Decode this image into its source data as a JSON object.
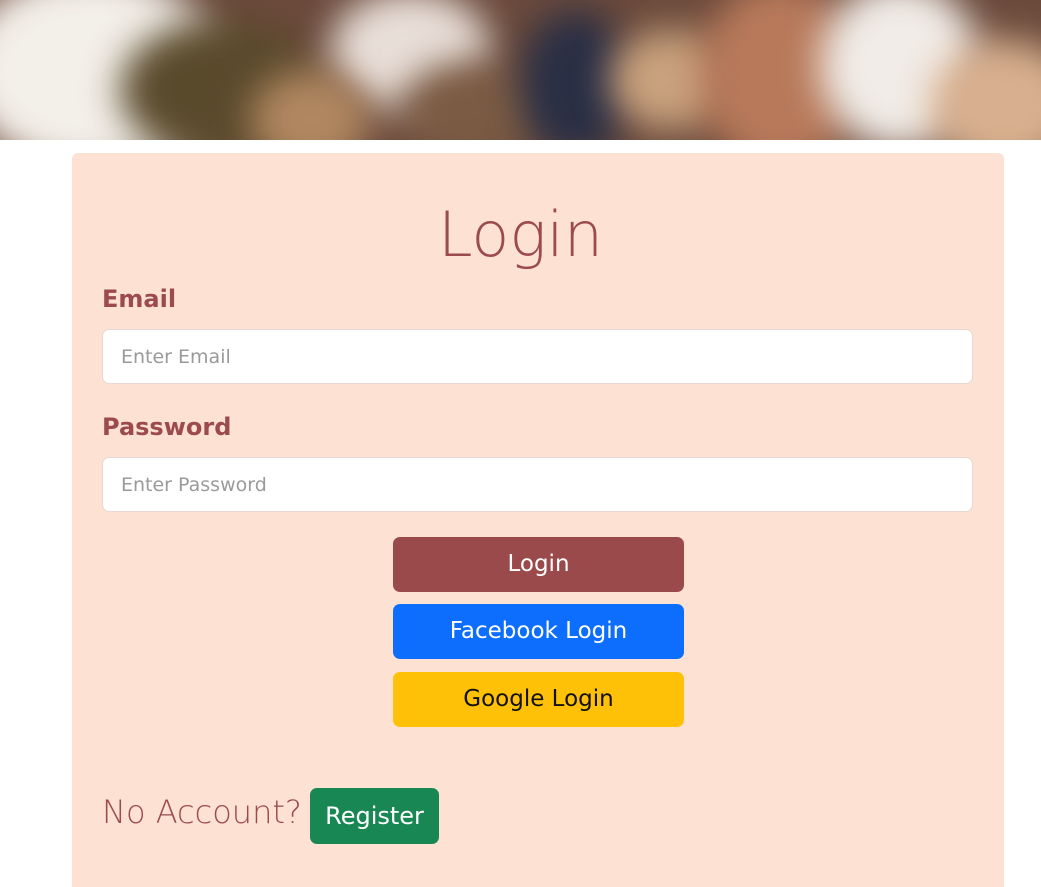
{
  "login": {
    "title": "Login",
    "email": {
      "label": "Email",
      "placeholder": "Enter Email",
      "value": ""
    },
    "password": {
      "label": "Password",
      "placeholder": "Enter Password",
      "value": ""
    },
    "buttons": {
      "login": "Login",
      "facebook": "Facebook Login",
      "google": "Google Login"
    },
    "footer": {
      "no_account_text": "No Account?",
      "register_label": "Register"
    }
  },
  "colors": {
    "card_background": "#fde1d3",
    "accent": "#9b4a4b",
    "facebook": "#0d6efd",
    "google": "#ffc107",
    "register": "#198754"
  }
}
